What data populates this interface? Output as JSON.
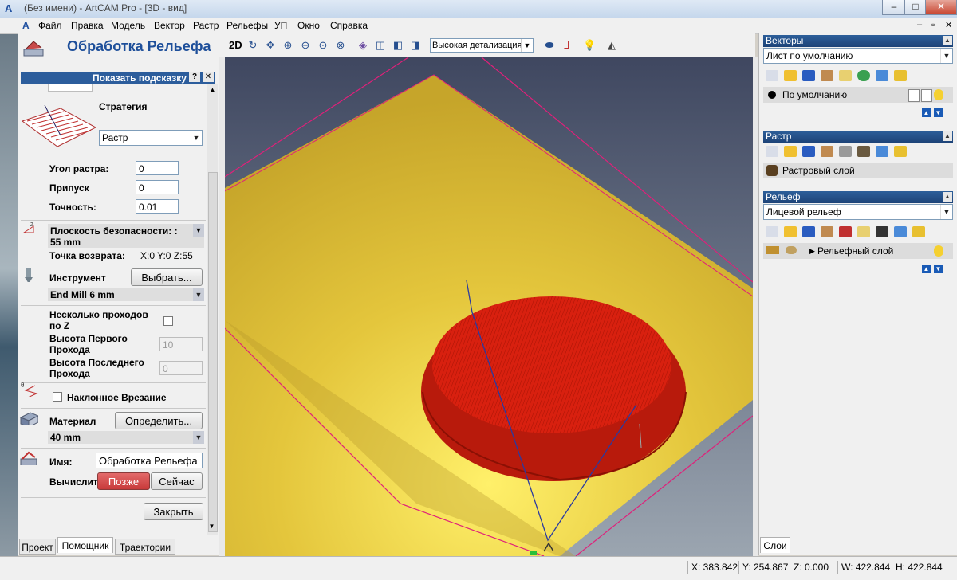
{
  "window": {
    "title": "(Без имени) - ArtCAM Pro - [3D - вид]",
    "buttons": [
      "–",
      "□",
      "✕"
    ],
    "mdi_buttons": [
      "–",
      "▫",
      "✕"
    ]
  },
  "menu": [
    "Файл",
    "Правка",
    "Модель",
    "Вектор",
    "Растр",
    "Рельефы",
    "УП",
    "Окно",
    "Справка"
  ],
  "left": {
    "title": "Обработка Рельефа",
    "hint": "Показать подсказку",
    "hint_btns": [
      "?",
      "✕"
    ],
    "strategy_label": "Стратегия",
    "strategy_value": "Растр",
    "raster_angle_label": "Угол растра:",
    "raster_angle": "0",
    "allowance_label": "Припуск",
    "allowance": "0",
    "accuracy_label": "Точность:",
    "accuracy": "0.01",
    "safe_z": "Плоскость безопасности: : 55 mm",
    "home_label": "Точка возврата:",
    "home_value": "X:0 Y:0 Z:55",
    "tool_label": "Инструмент",
    "tool_select": "Выбрать...",
    "tool_value": "End Mill 6 mm",
    "multipass_label": "Несколько проходов по Z",
    "first_pass_label": "Высота Первого Прохода",
    "first_pass": "10",
    "last_pass_label": "Высота Последнего Прохода",
    "last_pass": "0",
    "ramp_label": "Наклонное Врезание",
    "material_label": "Материал",
    "material_btn": "Определить...",
    "material_value": "40 mm",
    "name_label": "Имя:",
    "name_value": "Обработка Рельефа",
    "compute_label": "Вычислить:",
    "later_btn": "Позже",
    "now_btn": "Сейчас",
    "close_btn": "Закрыть"
  },
  "tabs": [
    "Проект",
    "Помощник",
    "Траектории"
  ],
  "toolbar": {
    "mode": "2D",
    "detail": "Высокая детализация"
  },
  "right": {
    "vectors_title": "Векторы",
    "vectors_sheet": "Лист по умолчанию",
    "vectors_layer": "По умолчанию",
    "raster_title": "Растр",
    "raster_layer": "Растровый слой",
    "relief_title": "Рельеф",
    "relief_value": "Лицевой рельеф",
    "relief_layer": "Рельефный слой",
    "layers_tab": "Слои"
  },
  "status": {
    "x": "X: 383.842",
    "y": "Y: 254.867",
    "z": "Z: 0.000",
    "w": "W: 422.844",
    "h": "H: 422.844"
  },
  "colors": {
    "board": "#e2c43a",
    "relief": "#d81e10",
    "boundary": "#e0207a",
    "toolpath": "#2a3aa0"
  }
}
